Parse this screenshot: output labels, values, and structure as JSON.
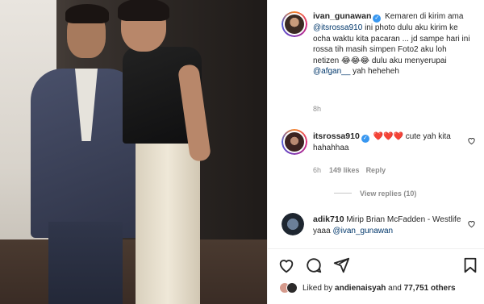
{
  "caption": {
    "username": "ivan_gunawan",
    "text_1": "Kemaren di kirim ama ",
    "mention_1": "@itsrossa910",
    "text_2": " ini photo dulu aku kirim ke ocha waktu kita pacaran ... jd sampe hari ini rossa tih masih simpen Foto2 aku loh netizen 😂😂😂 dulu aku menyerupai ",
    "mention_2": "@afgan__",
    "text_3": " yah heheheh",
    "time": "8h"
  },
  "comment_1": {
    "username": "itsrossa910",
    "text": "❤️❤️❤️ cute yah kita hahahhaa",
    "time": "6h",
    "likes": "149 likes",
    "reply": "Reply",
    "view_replies": "View replies (10)"
  },
  "comment_2": {
    "username": "adik710",
    "text": "Mirip Brian McFadden - Westlife yaaa ",
    "mention": "@ivan_gunawan"
  },
  "likes_bar": {
    "prefix": "Liked by ",
    "user": "andienaisyah",
    "middle": " and ",
    "count": "77,751 others"
  },
  "icons": {
    "like": "heart-icon",
    "comment": "comment-bubble-icon",
    "share": "send-icon",
    "save": "bookmark-icon"
  },
  "colors": {
    "mention": "#00376b",
    "verified": "#3897f0",
    "muted": "#8e8e8e"
  }
}
